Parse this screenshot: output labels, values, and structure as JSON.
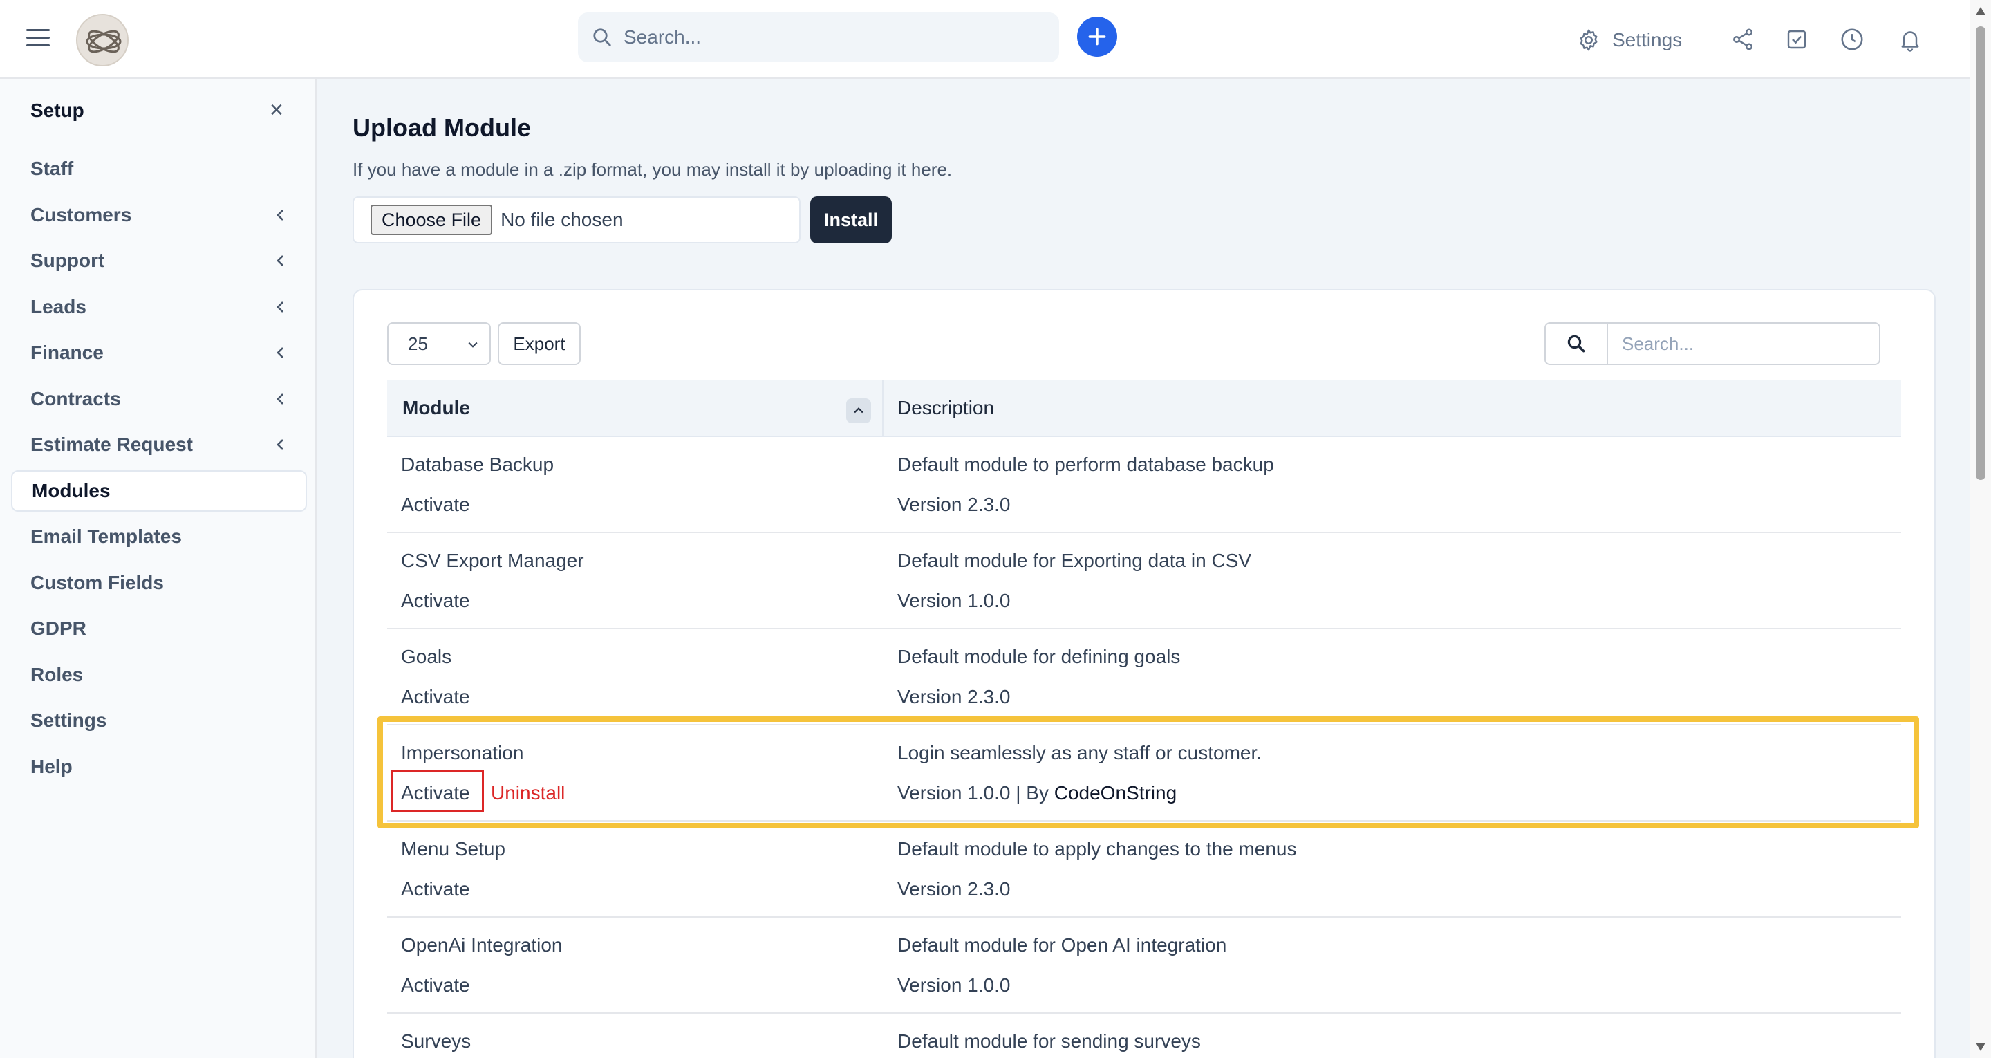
{
  "topbar": {
    "search_placeholder": "Search...",
    "settings_label": "Settings",
    "icons": [
      "menu-icon",
      "search-icon",
      "plus-icon",
      "gear-icon",
      "share-icon",
      "checkbox-icon",
      "clock-icon",
      "bell-icon"
    ]
  },
  "sidebar": {
    "title": "Setup",
    "items": [
      {
        "label": "Staff",
        "has_chevron": false
      },
      {
        "label": "Customers",
        "has_chevron": true
      },
      {
        "label": "Support",
        "has_chevron": true
      },
      {
        "label": "Leads",
        "has_chevron": true
      },
      {
        "label": "Finance",
        "has_chevron": true
      },
      {
        "label": "Contracts",
        "has_chevron": true
      },
      {
        "label": "Estimate Request",
        "has_chevron": true
      },
      {
        "label": "Modules",
        "has_chevron": false,
        "active": true
      },
      {
        "label": "Email Templates",
        "has_chevron": false
      },
      {
        "label": "Custom Fields",
        "has_chevron": false
      },
      {
        "label": "GDPR",
        "has_chevron": false
      },
      {
        "label": "Roles",
        "has_chevron": false
      },
      {
        "label": "Settings",
        "has_chevron": false
      },
      {
        "label": "Help",
        "has_chevron": false
      }
    ]
  },
  "main": {
    "title": "Upload Module",
    "subtitle": "If you have a module in a .zip format, you may install it by uploading it here.",
    "choose_file_label": "Choose File",
    "no_file_label": "No file chosen",
    "install_label": "Install"
  },
  "table": {
    "page_length": "25",
    "export_label": "Export",
    "search_placeholder": "Search...",
    "columns": [
      "Module",
      "Description"
    ],
    "rows": [
      {
        "name": "Database Backup",
        "actions": [
          "Activate"
        ],
        "description": "Default module to perform database backup",
        "version": "Version 2.3.0"
      },
      {
        "name": "CSV Export Manager",
        "actions": [
          "Activate"
        ],
        "description": "Default module for Exporting data in CSV",
        "version": "Version 1.0.0"
      },
      {
        "name": "Goals",
        "actions": [
          "Activate"
        ],
        "description": "Default module for defining goals",
        "version": "Version 2.3.0"
      },
      {
        "name": "Impersonation",
        "actions": [
          "Activate",
          "Uninstall"
        ],
        "description": "Login seamlessly as any staff or customer.",
        "version": "Version 1.0.0 | By ",
        "author": "CodeOnString",
        "highlighted": true
      },
      {
        "name": "Menu Setup",
        "actions": [
          "Activate"
        ],
        "description": "Default module to apply changes to the menus",
        "version": "Version 2.3.0"
      },
      {
        "name": "OpenAi Integration",
        "actions": [
          "Activate"
        ],
        "description": "Default module for Open AI integration",
        "version": "Version 1.0.0"
      },
      {
        "name": "Surveys",
        "actions": [
          "Activate"
        ],
        "description": "Default module for sending surveys",
        "version": ""
      }
    ]
  },
  "colors": {
    "accent": "#2563eb",
    "highlight": "#f5c33b",
    "danger": "#dc2626",
    "dark_button": "#1e293b"
  }
}
